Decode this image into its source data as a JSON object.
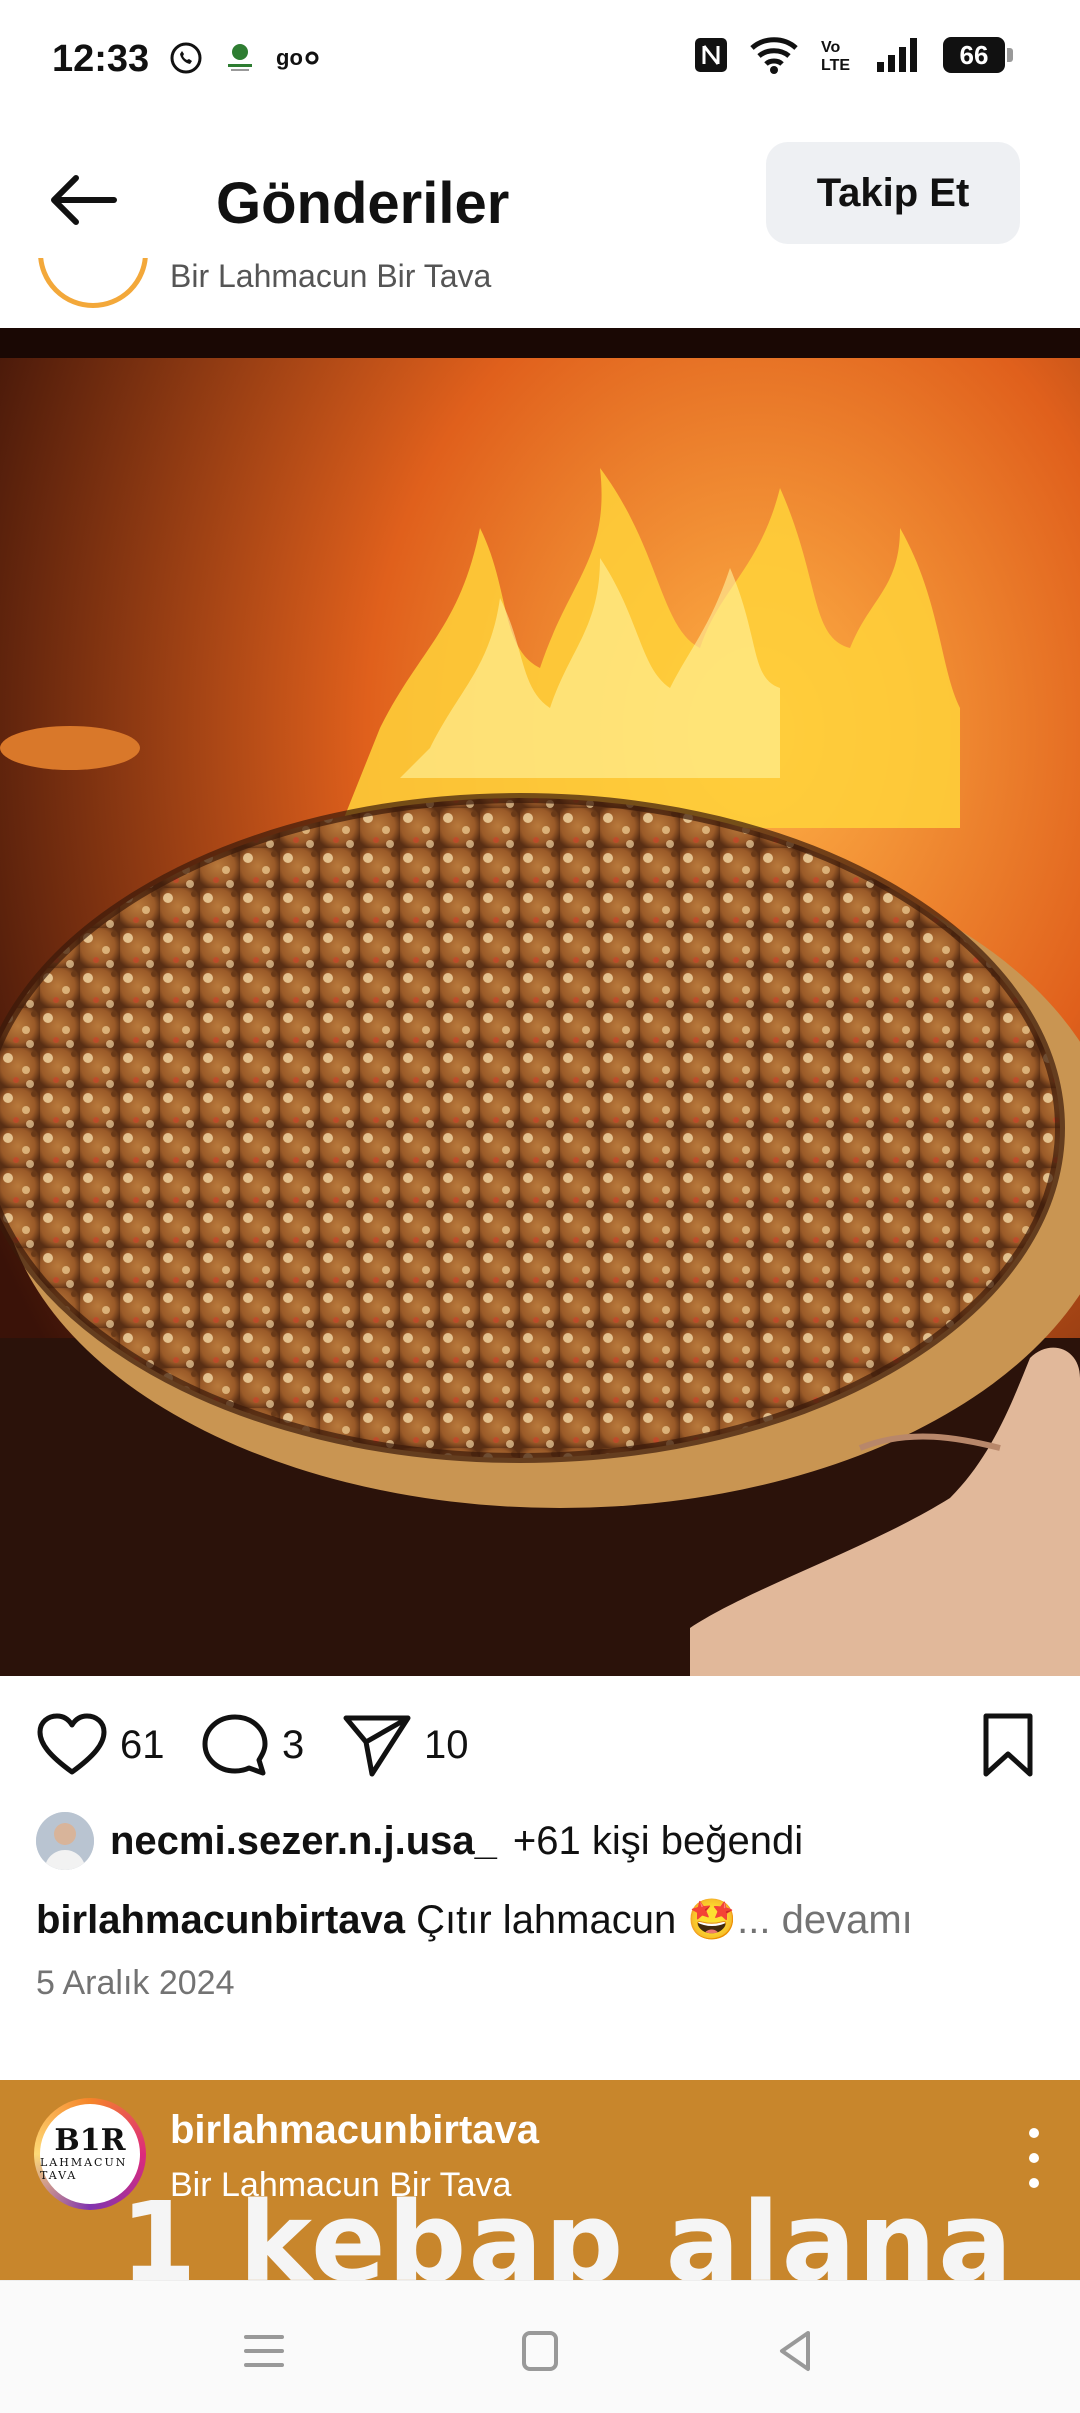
{
  "status_bar": {
    "time": "12:33",
    "battery": "66",
    "left_icons": [
      "whatsapp-icon",
      "app-icon",
      "goo-icon"
    ],
    "right_icons": [
      "nfc-icon",
      "wifi-icon",
      "volte-icon",
      "signal-icon"
    ]
  },
  "header": {
    "title": "Gönderiler",
    "follow_label": "Takip Et"
  },
  "prev_post": {
    "subtitle": "Bir Lahmacun Bir Tava"
  },
  "post": {
    "likes_count": "61",
    "comments_count": "3",
    "shares_count": "10",
    "liker_name": "necmi.sezer.n.j.usa_",
    "likes_text": "+61 kişi beğendi",
    "author": "birlahmacunbirtava",
    "caption": "Çıtır lahmacun 🤩",
    "more": "... devamı",
    "date": "5 Aralık 2024"
  },
  "next_post": {
    "username": "birlahmacunbirtava",
    "subtitle": "Bir Lahmacun Bir Tava",
    "bg_text": "1 kebap alana",
    "logo_main": "B1R",
    "logo_sub": "LAHMACUN TAVA"
  },
  "colors": {
    "follow_bg": "#eef0f3",
    "muted": "#737373",
    "next_post_bg": "#c8862c"
  }
}
